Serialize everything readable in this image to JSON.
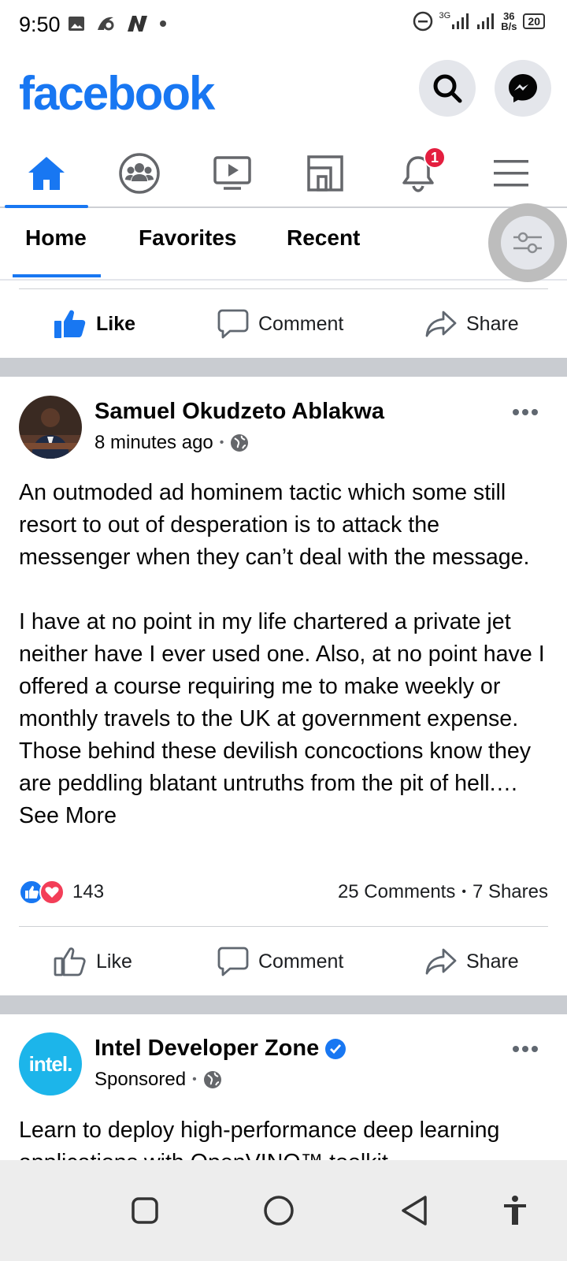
{
  "status_bar": {
    "time": "9:50",
    "network": "3G",
    "speed_value": "36",
    "speed_unit": "B/s",
    "battery": "20"
  },
  "header": {
    "logo": "facebook",
    "brand_color": "#1877f2"
  },
  "tabs": {
    "notification_count": "1",
    "items": [
      "home-icon",
      "groups-icon",
      "video-icon",
      "marketplace-icon",
      "notifications-icon",
      "menu-icon"
    ]
  },
  "feed_filters": {
    "home": "Home",
    "favorites": "Favorites",
    "recent": "Recent"
  },
  "actions": {
    "like": "Like",
    "comment": "Comment",
    "share": "Share"
  },
  "post1": {
    "author": "Samuel Okudzeto Ablakwa",
    "time": "8 minutes ago",
    "dot": "•",
    "paragraph1": "An outmoded ad hominem tactic which some still resort to out of desperation is to attack the messenger when they can’t deal with the message.",
    "paragraph2": "I have at no point in my life chartered a private jet neither have I ever used one. Also, at no point have I offered a course requiring me to make weekly or monthly travels to the UK at government expense. Those behind these devilish concoctions know they are peddling blatant untruths from the pit of hell.…",
    "see_more": "See More",
    "reaction_count": "143",
    "comments": "25 Comments",
    "shares": "7 Shares",
    "stats_dot": "•"
  },
  "post2": {
    "author": "Intel Developer Zone",
    "sponsored": "Sponsored",
    "dot": "•",
    "avatar_text": "intel.",
    "text": "Learn to deploy high-performance deep learning applications with OpenVINO™ toolkit"
  }
}
